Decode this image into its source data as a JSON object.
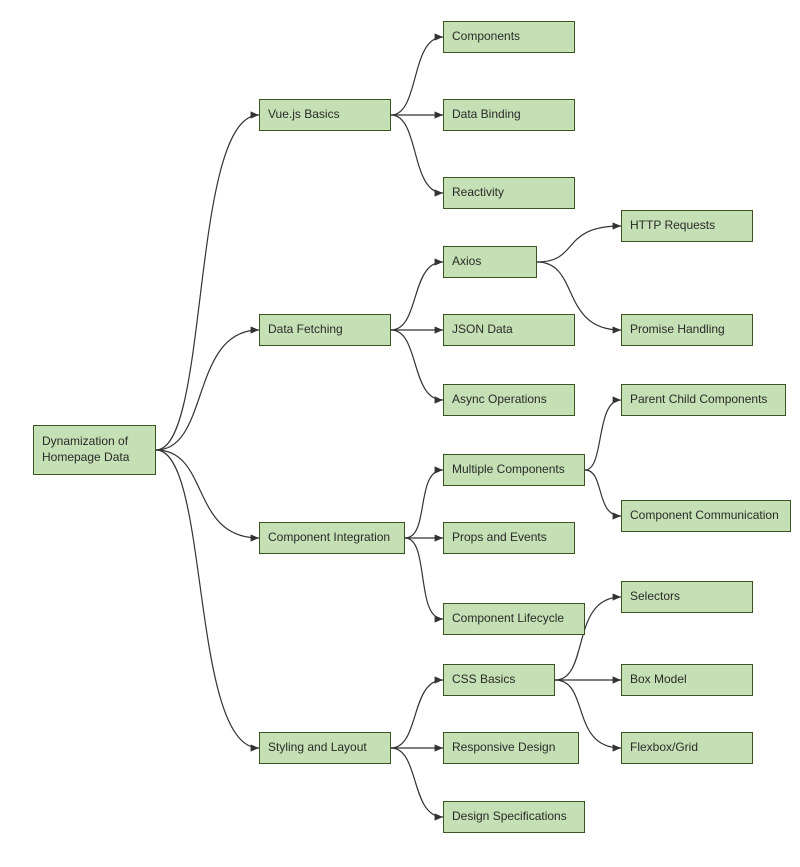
{
  "chart_data": {
    "type": "tree",
    "root": "Dynamization of Homepage Data",
    "children": [
      {
        "label": "Vue.js Basics",
        "children": [
          "Components",
          "Data Binding",
          "Reactivity"
        ]
      },
      {
        "label": "Data Fetching",
        "children": [
          {
            "label": "Axios",
            "children": [
              "HTTP Requests",
              "Promise Handling"
            ]
          },
          "JSON Data",
          "Async Operations"
        ]
      },
      {
        "label": "Component Integration",
        "children": [
          {
            "label": "Multiple Components",
            "children": [
              "Parent Child Components",
              "Component Communication"
            ]
          },
          "Props and Events",
          "Component Lifecycle"
        ]
      },
      {
        "label": "Styling and Layout",
        "children": [
          {
            "label": "CSS Basics",
            "children": [
              "Selectors",
              "Box Model",
              "Flexbox/Grid"
            ]
          },
          "Responsive Design",
          "Design Specifications"
        ]
      }
    ]
  },
  "colors": {
    "node_fill": "#c5e0b4",
    "node_border": "#3a5520",
    "edge": "#333333"
  },
  "nodes": {
    "root": "Dynamization of\nHomepage Data",
    "vue": "Vue.js Basics",
    "components": "Components",
    "databind": "Data Binding",
    "reactivity": "Reactivity",
    "datafetch": "Data Fetching",
    "axios": "Axios",
    "httpreq": "HTTP Requests",
    "promise": "Promise Handling",
    "json": "JSON Data",
    "async": "Async Operations",
    "compint": "Component Integration",
    "multicomp": "Multiple Components",
    "parentchild": "Parent Child Components",
    "compcomm": "Component Communication",
    "propsevt": "Props and Events",
    "complife": "Component Lifecycle",
    "styling": "Styling and Layout",
    "cssbasics": "CSS Basics",
    "selectors": "Selectors",
    "boxmodel": "Box Model",
    "flexgrid": "Flexbox/Grid",
    "respdesign": "Responsive Design",
    "designspec": "Design Specifications"
  }
}
